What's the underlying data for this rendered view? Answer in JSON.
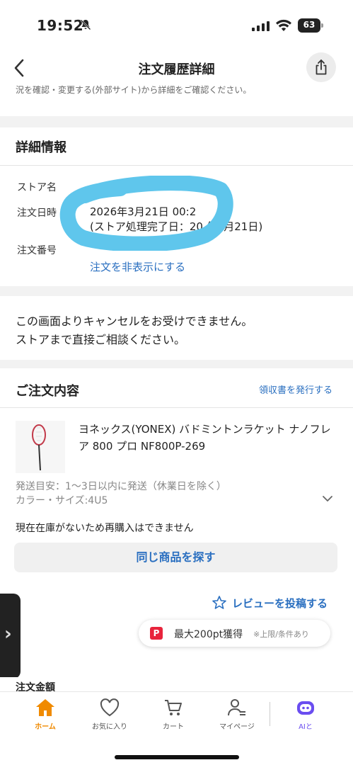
{
  "status_bar": {
    "time": "19:52",
    "battery": "63"
  },
  "nav": {
    "title": "注文履歴詳細"
  },
  "top_clip_text": "況を確認・変更する(外部サイト)から詳細をご確認ください。",
  "detail": {
    "heading": "詳細情報",
    "store_label": "ストア名",
    "date_label": "注文日時",
    "date_value": "2026年3月21日 00:2",
    "date_sub": "(ストア処理完了日：20  年3月21日)",
    "number_label": "注文番号",
    "hide_link": "注文を非表示にする"
  },
  "notice": {
    "line1": "この画面よりキャンセルをお受けできません。",
    "line2": "ストアまで直接ご相談ください。"
  },
  "order": {
    "heading": "ご注文内容",
    "receipt_link": "領収書を発行する",
    "product_name": "ヨネックス(YONEX) バドミントンラケット ナノフレア 800 プロ NF800P-269",
    "shipping": "発送目安：1〜3日以内に発送（休業日を除く）",
    "variant": "カラー・サイズ:4U5",
    "stock_note": "現在在庫がないため再購入はできません",
    "find_button": "同じ商品を探す",
    "review_link": "レビューを投稿する",
    "points_main": "最大200pt獲得",
    "points_note": "※上限/条件あり"
  },
  "amount_heading": "注文金額",
  "tabbar": {
    "tabs": [
      {
        "label": "ホーム",
        "icon": "home-icon",
        "active": true
      },
      {
        "label": "お気に入り",
        "icon": "heart-icon",
        "active": false
      },
      {
        "label": "カート",
        "icon": "cart-icon",
        "active": false
      },
      {
        "label": "マイページ",
        "icon": "user-icon",
        "active": false
      },
      {
        "label": "AIと",
        "icon": "ai-bot-icon",
        "active": false
      }
    ]
  },
  "colors": {
    "accent": "#2a6fc0",
    "home_active": "#f08a00",
    "paypay_red": "#e8243c",
    "redaction": "#5fc6ec"
  }
}
